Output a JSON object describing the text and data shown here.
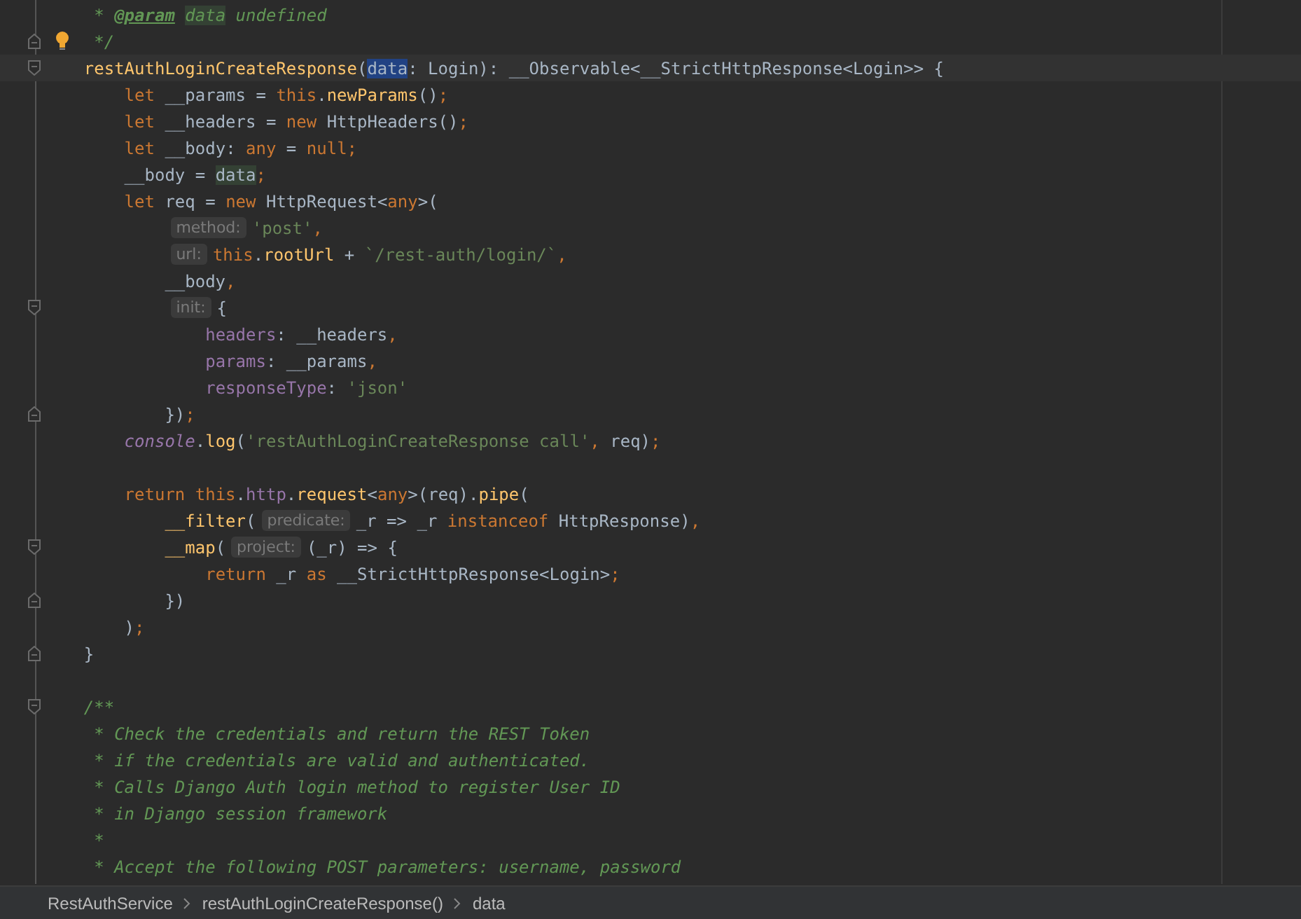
{
  "editor": {
    "lines": [
      {
        "tokens": [
          {
            "text": " * ",
            "kind": "doc"
          },
          {
            "text": "@param",
            "kind": "doctag"
          },
          {
            "text": "data",
            "kind": "docusage"
          },
          {
            "text": " undefined",
            "kind": "doc"
          }
        ]
      },
      {
        "fold_end": true,
        "bulb": true,
        "tokens": [
          {
            "text": " */",
            "kind": "doc"
          }
        ]
      },
      {
        "fold_start": true,
        "current": true,
        "tokens": [
          {
            "text": "restAuthLoginCreateResponse",
            "kind": "fn"
          },
          {
            "text": "(",
            "kind": "plain"
          },
          {
            "text": "data",
            "kind": "sel"
          },
          {
            "text": ": Login): __Observable<__StrictHttpResponse<Login>> {",
            "kind": "plain"
          }
        ],
        "children": [
          {
            "tokens": [
              {
                "text": "let",
                "kind": "kw"
              },
              {
                "text": " __params = ",
                "kind": "plain"
              },
              {
                "text": "this",
                "kind": "kw"
              },
              {
                "text": ".",
                "kind": "plain"
              },
              {
                "text": "newParams",
                "kind": "fn"
              },
              {
                "text": "()",
                "kind": "plain"
              },
              {
                "text": ";",
                "kind": "kw"
              }
            ]
          },
          {
            "tokens": [
              {
                "text": "let",
                "kind": "kw"
              },
              {
                "text": " __headers = ",
                "kind": "plain"
              },
              {
                "text": "new",
                "kind": "kw"
              },
              {
                "text": " HttpHeaders()",
                "kind": "plain"
              },
              {
                "text": ";",
                "kind": "kw"
              }
            ]
          },
          {
            "tokens": [
              {
                "text": "let",
                "kind": "kw"
              },
              {
                "text": " __body",
                "kind": "plain"
              },
              {
                "text": ": ",
                "kind": "plain"
              },
              {
                "text": "any",
                "kind": "kw"
              },
              {
                "text": " = ",
                "kind": "plain"
              },
              {
                "text": "null",
                "kind": "kw"
              },
              {
                "text": ";",
                "kind": "kw"
              }
            ]
          },
          {
            "tokens": [
              {
                "text": "__body = ",
                "kind": "plain"
              },
              {
                "text": "data",
                "kind": "usage"
              },
              {
                "text": ";",
                "kind": "kw"
              }
            ]
          },
          {
            "tokens": [
              {
                "text": "let",
                "kind": "kw"
              },
              {
                "text": " req = ",
                "kind": "plain"
              },
              {
                "text": "new",
                "kind": "kw"
              },
              {
                "text": " HttpRequest<",
                "kind": "plain"
              },
              {
                "text": "any",
                "kind": "kw"
              },
              {
                "text": ">(",
                "kind": "plain"
              }
            ],
            "children": [
              {
                "tokens": [
                  {
                    "text": "method:",
                    "kind": "hint"
                  },
                  {
                    "text": "'post'",
                    "kind": "str"
                  },
                  {
                    "text": ",",
                    "kind": "kw"
                  }
                ]
              },
              {
                "tokens": [
                  {
                    "text": "url:",
                    "kind": "hint"
                  },
                  {
                    "text": "this",
                    "kind": "kw"
                  },
                  {
                    "text": ".",
                    "kind": "plain"
                  },
                  {
                    "text": "rootUrl",
                    "kind": "fn"
                  },
                  {
                    "text": " + ",
                    "kind": "plain"
                  },
                  {
                    "text": "`/rest-auth/login/`",
                    "kind": "str"
                  },
                  {
                    "text": ",",
                    "kind": "kw"
                  }
                ]
              },
              {
                "tokens": [
                  {
                    "text": "__body",
                    "kind": "plain"
                  },
                  {
                    "text": ",",
                    "kind": "kw"
                  }
                ]
              },
              {
                "fold_start": true,
                "tokens": [
                  {
                    "text": "init:",
                    "kind": "hint"
                  },
                  {
                    "text": "{",
                    "kind": "plain"
                  }
                ],
                "children": [
                  {
                    "tokens": [
                      {
                        "text": "headers",
                        "kind": "field"
                      },
                      {
                        "text": ": __headers",
                        "kind": "plain"
                      },
                      {
                        "text": ",",
                        "kind": "kw"
                      }
                    ]
                  },
                  {
                    "tokens": [
                      {
                        "text": "params",
                        "kind": "field"
                      },
                      {
                        "text": ": __params",
                        "kind": "plain"
                      },
                      {
                        "text": ",",
                        "kind": "kw"
                      }
                    ]
                  },
                  {
                    "tokens": [
                      {
                        "text": "responseType",
                        "kind": "field"
                      },
                      {
                        "text": ": ",
                        "kind": "plain"
                      },
                      {
                        "text": "'json'",
                        "kind": "str"
                      }
                    ]
                  }
                ]
              },
              {
                "fold_end": true,
                "tokens": [
                  {
                    "text": "})",
                    "kind": "plain"
                  },
                  {
                    "text": ";",
                    "kind": "kw"
                  }
                ]
              }
            ]
          },
          {
            "blank_after": true,
            "tokens": [
              {
                "text": "console",
                "kind": "global"
              },
              {
                "text": ".",
                "kind": "plain"
              },
              {
                "text": "log",
                "kind": "fn"
              },
              {
                "text": "(",
                "kind": "plain"
              },
              {
                "text": "'restAuthLoginCreateResponse call'",
                "kind": "str"
              },
              {
                "text": ",",
                "kind": "kw"
              },
              {
                "text": " req)",
                "kind": "plain"
              },
              {
                "text": ";",
                "kind": "kw"
              }
            ]
          },
          {
            "tokens": [
              {
                "text": "return ",
                "kind": "kw"
              },
              {
                "text": "this",
                "kind": "kw"
              },
              {
                "text": ".",
                "kind": "plain"
              },
              {
                "text": "http",
                "kind": "field"
              },
              {
                "text": ".",
                "kind": "plain"
              },
              {
                "text": "request",
                "kind": "fn"
              },
              {
                "text": "<",
                "kind": "plain"
              },
              {
                "text": "any",
                "kind": "kw"
              },
              {
                "text": ">(req).",
                "kind": "plain"
              },
              {
                "text": "pipe",
                "kind": "fn"
              },
              {
                "text": "(",
                "kind": "plain"
              }
            ],
            "children": [
              {
                "tokens": [
                  {
                    "text": "__filter",
                    "kind": "fn"
                  },
                  {
                    "text": "(",
                    "kind": "plain"
                  },
                  {
                    "text": "predicate:",
                    "kind": "hint"
                  },
                  {
                    "text": "_r => _r ",
                    "kind": "plain"
                  },
                  {
                    "text": "instanceof",
                    "kind": "kw"
                  },
                  {
                    "text": " HttpResponse)",
                    "kind": "plain"
                  },
                  {
                    "text": ",",
                    "kind": "kw"
                  }
                ]
              },
              {
                "fold_start": true,
                "tokens": [
                  {
                    "text": "__map",
                    "kind": "fn"
                  },
                  {
                    "text": "(",
                    "kind": "plain"
                  },
                  {
                    "text": "project:",
                    "kind": "hint"
                  },
                  {
                    "text": "(_r) => {",
                    "kind": "plain"
                  }
                ],
                "children": [
                  {
                    "tokens": [
                      {
                        "text": "return",
                        "kind": "kw"
                      },
                      {
                        "text": " _r ",
                        "kind": "plain"
                      },
                      {
                        "text": "as",
                        "kind": "kw"
                      },
                      {
                        "text": " __StrictHttpResponse<Login>",
                        "kind": "plain"
                      },
                      {
                        "text": ";",
                        "kind": "kw"
                      }
                    ]
                  }
                ]
              },
              {
                "fold_end": true,
                "tokens": [
                  {
                    "text": "})",
                    "kind": "plain"
                  }
                ]
              }
            ]
          },
          {
            "tokens": [
              {
                "text": ")",
                "kind": "plain"
              },
              {
                "text": ";",
                "kind": "kw"
              }
            ]
          }
        ]
      },
      {
        "fold_end": true,
        "blank_after": true,
        "tokens": [
          {
            "text": "}",
            "kind": "plain"
          }
        ]
      },
      {
        "fold_start": true,
        "tokens": [
          {
            "text": "/**",
            "kind": "doc"
          }
        ]
      },
      {
        "tokens": [
          {
            "text": " * Check the credentials and return the REST Token",
            "kind": "doc"
          }
        ]
      },
      {
        "tokens": [
          {
            "text": " * if the credentials are valid and authenticated.",
            "kind": "doc"
          }
        ]
      },
      {
        "tokens": [
          {
            "text": " * Calls Django Auth login method to register User ID",
            "kind": "doc"
          }
        ]
      },
      {
        "tokens": [
          {
            "text": " * in Django session framework",
            "kind": "doc"
          }
        ]
      },
      {
        "tokens": [
          {
            "text": " *",
            "kind": "doc"
          }
        ]
      },
      {
        "tokens": [
          {
            "text": " * Accept the following POST parameters: username, password",
            "kind": "doc"
          }
        ]
      }
    ]
  },
  "breadcrumb": [
    "RestAuthService",
    "restAuthLoginCreateResponse()",
    "data"
  ]
}
